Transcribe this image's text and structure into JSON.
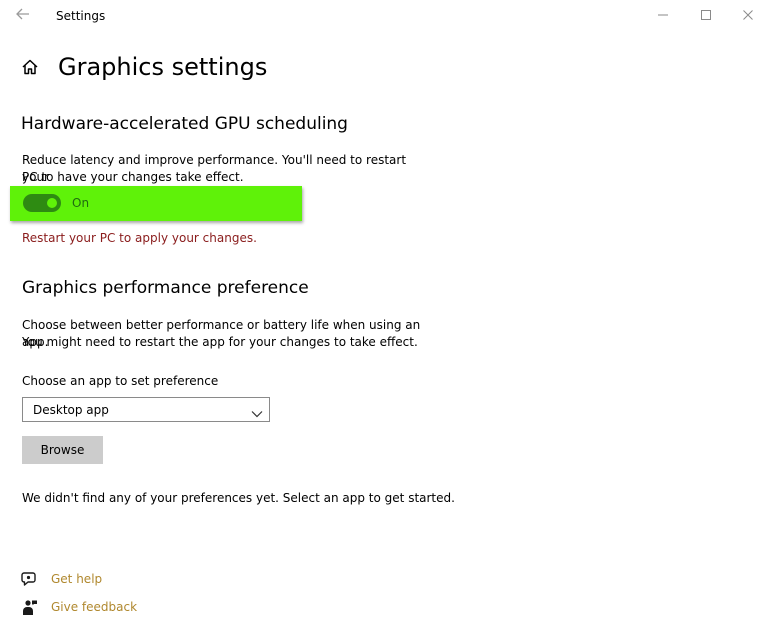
{
  "window": {
    "title": "Settings",
    "back_icon": "back-arrow-icon",
    "controls": [
      "minimize-icon",
      "maximize-icon",
      "close-icon"
    ]
  },
  "header": {
    "icon": "home-icon",
    "title": "Graphics settings"
  },
  "gpu_scheduling": {
    "title": "Hardware-accelerated GPU scheduling",
    "description_line1": "Reduce latency and improve performance. You'll need to restart your",
    "description_line2": "PC to have your changes take effect.",
    "toggle_state": "On",
    "toggle_on": true,
    "restart_message": "Restart your PC to apply your changes."
  },
  "performance": {
    "title": "Graphics performance preference",
    "description_line1": "Choose between better performance or battery life when using an app.",
    "description_line2": "You might need to restart the app for your changes to take effect.",
    "select_label": "Choose an app to set preference",
    "select_value": "Desktop app",
    "browse_label": "Browse",
    "empty_message": "We didn't find any of your preferences yet. Select an app to get started."
  },
  "footer": {
    "help_label": "Get help",
    "help_icon": "chat-help-icon",
    "feedback_label": "Give feedback",
    "feedback_icon": "feedback-person-icon"
  },
  "colors": {
    "highlight": "#5ff209",
    "toggle_on": "#2e8b12",
    "warning_text": "#8a1c1c",
    "link_text": "#b0882e",
    "button_bg": "#cccccc"
  }
}
